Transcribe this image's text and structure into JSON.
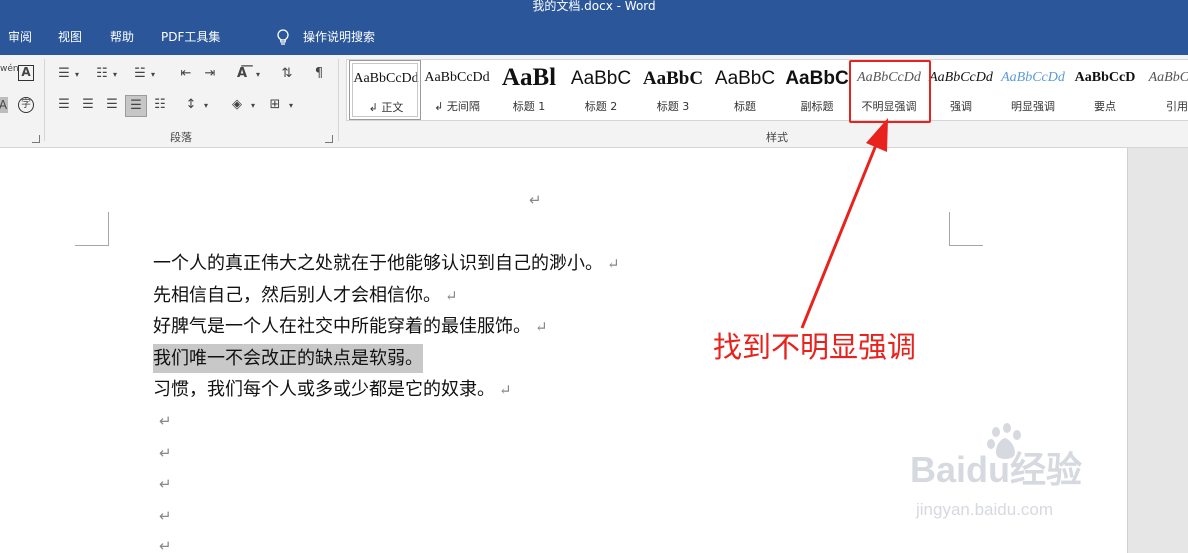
{
  "window": {
    "title": "我的文档.docx  -  Word"
  },
  "menu": {
    "items": [
      "审阅",
      "视图",
      "帮助",
      "PDF工具集",
      "操作说明搜索"
    ]
  },
  "ribbon": {
    "paragraph_group_label": "段落",
    "styles_group_label": "样式",
    "left_edge_text": "wén",
    "styles": [
      {
        "sample": "AaBbCcDd",
        "name": "↲ 正文",
        "selected": true
      },
      {
        "sample": "AaBbCcDd",
        "name": "↲ 无间隔"
      },
      {
        "sample": "AaBl",
        "name": "标题 1"
      },
      {
        "sample": "AaBbC",
        "name": "标题 2"
      },
      {
        "sample": "AaBbC",
        "name": "标题 3"
      },
      {
        "sample": "AaBbC",
        "name": "标题"
      },
      {
        "sample": "AaBbC",
        "name": "副标题"
      },
      {
        "sample": "AaBbCcDd",
        "name": "不明显强调"
      },
      {
        "sample": "AaBbCcDd",
        "name": "强调"
      },
      {
        "sample": "AaBbCcDd",
        "name": "明显强调"
      },
      {
        "sample": "AaBbCcD",
        "name": "要点"
      },
      {
        "sample": "AaBbCcD",
        "name": "引用"
      }
    ]
  },
  "document": {
    "top_mark": "↵",
    "paragraphs": [
      {
        "text": "一个人的真正伟大之处就在于他能够认识到自己的渺小。",
        "mark": "↵"
      },
      {
        "text": "先相信自己，然后别人才会相信你。",
        "mark": "↵"
      },
      {
        "text": "好脾气是一个人在社交中所能穿着的最佳服饰。",
        "mark": "↵"
      },
      {
        "text": "我们唯一不会改正的缺点是软弱。",
        "mark": ""
      },
      {
        "text": "习惯，我们每个人或多或少都是它的奴隶。",
        "mark": "↵"
      }
    ],
    "empty_mark": "↵"
  },
  "annotation": {
    "text": "找到不明显强调",
    "color": "#e8231e"
  },
  "watermark": {
    "brand": "Baidu经验",
    "url": "jingyan.baidu.com"
  },
  "colors": {
    "titlebar": "#2b579a",
    "selection": "#c8c8c8",
    "annotation": "#e8231e"
  }
}
